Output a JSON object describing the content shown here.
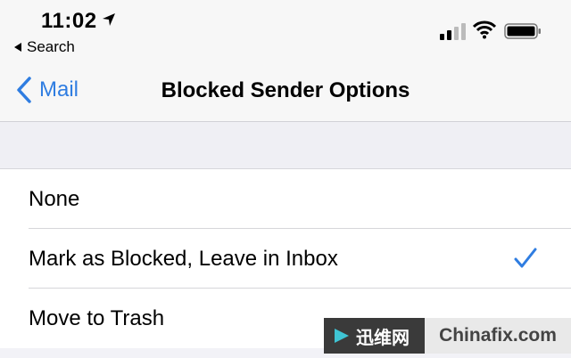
{
  "status_bar": {
    "time": "11:02",
    "back_app_label": "Search",
    "icons": [
      "location-arrow-icon",
      "cellular-signal-icon",
      "wifi-icon",
      "battery-icon"
    ]
  },
  "nav": {
    "back_label": "Mail",
    "title": "Blocked Sender Options"
  },
  "options": [
    {
      "label": "None",
      "selected": false
    },
    {
      "label": "Mark as Blocked, Leave in Inbox",
      "selected": true
    },
    {
      "label": "Move to Trash",
      "selected": false
    }
  ],
  "watermark": {
    "left_text": "迅维网",
    "right_text": "Chinafix.com"
  },
  "colors": {
    "accent": "#2f7de1",
    "background": "#f2f2f7",
    "watermark_dark": "#3a3a3a",
    "watermark_light": "#e9e9e9"
  }
}
